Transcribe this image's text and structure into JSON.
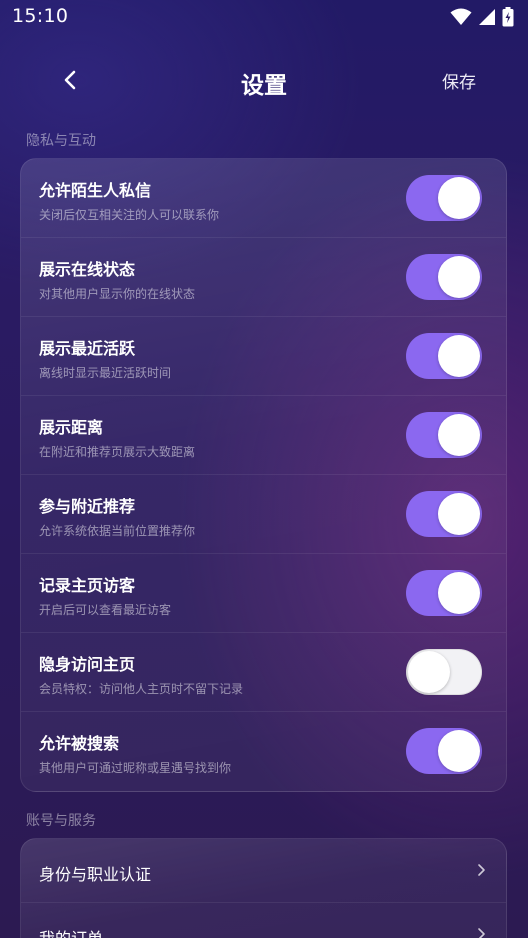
{
  "status": {
    "time": "15:10",
    "icons": [
      "wifi-icon",
      "signal-icon",
      "battery-charging-icon"
    ]
  },
  "nav": {
    "back_icon": "chevron-left-icon",
    "title": "设置",
    "save_label": "保存"
  },
  "privacy": {
    "label": "隐私与互动",
    "items": [
      {
        "title": "允许陌生人私信",
        "subtitle": "关闭后仅互相关注的人可以联系你",
        "on": true
      },
      {
        "title": "展示在线状态",
        "subtitle": "对其他用户显示你的在线状态",
        "on": true
      },
      {
        "title": "展示最近活跃",
        "subtitle": "离线时显示最近活跃时间",
        "on": true
      },
      {
        "title": "展示距离",
        "subtitle": "在附近和推荐页展示大致距离",
        "on": true
      },
      {
        "title": "参与附近推荐",
        "subtitle": "允许系统依据当前位置推荐你",
        "on": true
      },
      {
        "title": "记录主页访客",
        "subtitle": "开启后可以查看最近访客",
        "on": true
      },
      {
        "title": "隐身访问主页",
        "subtitle": "会员特权：访问他人主页时不留下记录",
        "on": false
      },
      {
        "title": "允许被搜索",
        "subtitle": "其他用户可通过昵称或星遇号找到你",
        "on": true
      }
    ]
  },
  "account": {
    "label": "账号与服务",
    "items": [
      {
        "title": "身份与职业认证"
      },
      {
        "title": "我的订单"
      }
    ]
  },
  "colors": {
    "toggle_on": "#8b68f0",
    "toggle_off": "#f2f2f5"
  }
}
